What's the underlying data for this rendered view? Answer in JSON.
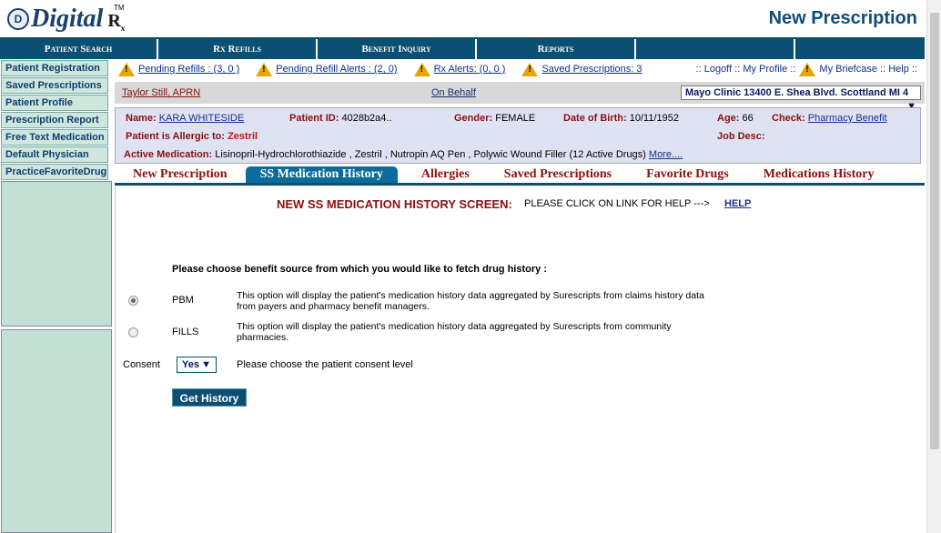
{
  "header": {
    "logo_text": "Digital",
    "logo_r": "R",
    "logo_sub": "x",
    "logo_tm": "TM",
    "page_title": "New Prescription"
  },
  "topnav": {
    "items": [
      {
        "label": "Patient Search"
      },
      {
        "label": "Rx Refills"
      },
      {
        "label": "Benefit Inquiry"
      },
      {
        "label": "Reports"
      },
      {
        "label": ""
      },
      {
        "label": ""
      }
    ]
  },
  "sidebar": {
    "items": [
      {
        "label": "Patient Registration"
      },
      {
        "label": "Saved Prescriptions"
      },
      {
        "label": "Patient Profile"
      },
      {
        "label": "Prescription Report"
      },
      {
        "label": "Free Text Medication"
      },
      {
        "label": "Default Physician"
      },
      {
        "label": "PracticeFavoriteDrugs"
      }
    ]
  },
  "alerts": {
    "pending_refills": "Pending Refills : (3, 0 )",
    "pending_refill_alerts": "Pending Refill Alerts : (2, 0)",
    "rx_alerts": "Rx Alerts: (0, 0 )",
    "saved_prescriptions": "Saved Prescriptions: 3",
    "logoff": ":: Logoff :: My Profile ::",
    "briefcase": "My Briefcase :: Help ::"
  },
  "userbar": {
    "user": "Taylor Still, APRN",
    "on_behalf": "On Behalf",
    "clinic": "Mayo Clinic 13400 E. Shea Blvd. Scottland MI 4"
  },
  "patient": {
    "name_label": "Name:",
    "name": "KARA WHITESIDE",
    "id_label": "Patient ID:",
    "id": "4028b2a4..",
    "gender_label": "Gender:",
    "gender": "FEMALE",
    "dob_label": "Date of Birth:",
    "dob": "10/11/1952",
    "age_label": "Age:",
    "age": "66",
    "check_label": "Check:",
    "check_link": "Pharmacy Benefit",
    "allergic_label": "Patient is Allergic to:",
    "allergic": "Zestril",
    "jobdesc_label": "Job Desc:",
    "active_label": "Active Medication:",
    "active": "Lisinopril-Hydrochlorothiazide , Zestril , Nutropin AQ Pen , Polywic Wound Filler (12 Active Drugs)",
    "more": "More...."
  },
  "tabs": [
    {
      "label": "New Prescription"
    },
    {
      "label": "SS Medication History"
    },
    {
      "label": "Allergies"
    },
    {
      "label": "Saved Prescriptions"
    },
    {
      "label": "Favorite Drugs"
    },
    {
      "label": "Medications History"
    }
  ],
  "content": {
    "title": "NEW SS MEDICATION HISTORY SCREEN:",
    "help_note": "PLEASE CLICK ON LINK FOR HELP --->",
    "help_link": "HELP",
    "choose": "Please choose benefit source from which you would like to fetch drug history :",
    "pbm_label": "PBM",
    "pbm_desc": "This option will display the patient's medication history data aggregated by Surescripts from claims history data from payers and pharmacy benefit managers.",
    "fills_label": "FILLS",
    "fills_desc": "This option will display the patient's medication history data aggregated by Surescripts from community pharmacies.",
    "consent_label": "Consent",
    "consent_value": "Yes",
    "consent_note": "Please choose the patient consent level",
    "button": "Get History"
  }
}
